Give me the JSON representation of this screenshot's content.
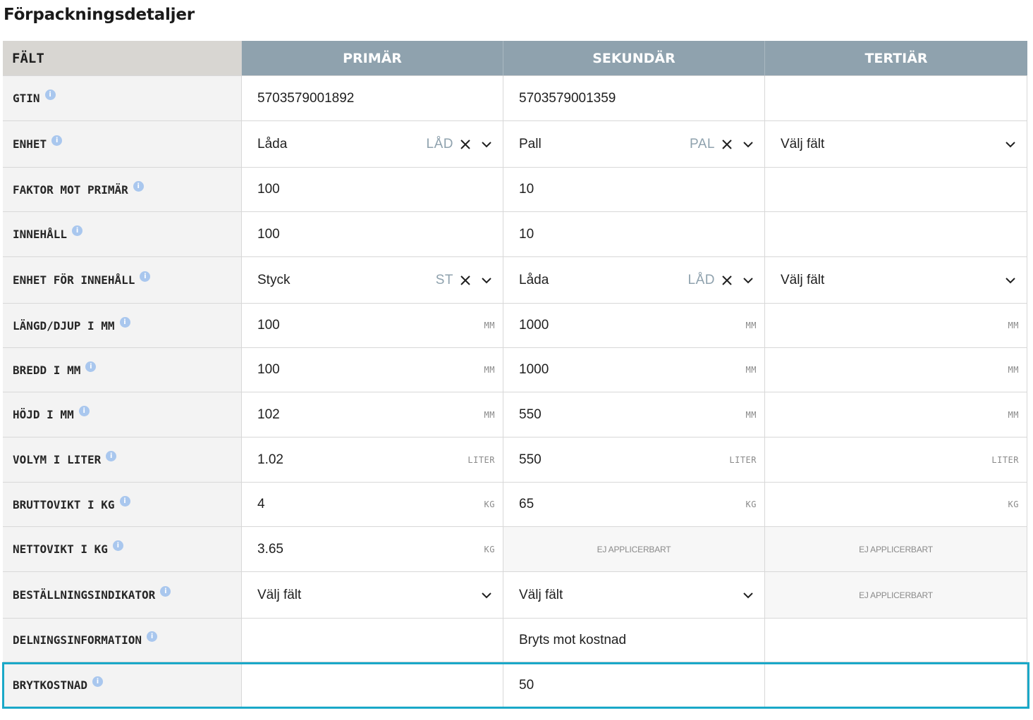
{
  "title": "Förpackningsdetaljer",
  "headers": {
    "field": "FÄLT",
    "primary": "PRIMÄR",
    "secondary": "SEKUNDÄR",
    "tertiary": "TERTIÄR"
  },
  "info_glyph": "i",
  "icons": {
    "clear": "close-icon",
    "dropdown": "chevron-down-icon",
    "info": "info-icon"
  },
  "colors": {
    "header_bg": "#8fa2ae",
    "field_header_bg": "#d8d6d2",
    "label_bg": "#f3f3f3",
    "highlight": "#1aa8c8",
    "info": "#a9c7ee"
  },
  "rows": [
    {
      "label": "GTIN",
      "primary": {
        "value": "5703579001892"
      },
      "secondary": {
        "value": "5703579001359"
      },
      "tertiary": {
        "value": ""
      }
    },
    {
      "label": "ENHET",
      "primary": {
        "value": "Låda",
        "abbr": "LÅD"
      },
      "secondary": {
        "value": "Pall",
        "abbr": "PAL"
      },
      "tertiary": {
        "value": "Välj fält"
      }
    },
    {
      "label": "FAKTOR MOT PRIMÄR",
      "primary": {
        "value": "100"
      },
      "secondary": {
        "value": "10"
      },
      "tertiary": {
        "value": ""
      }
    },
    {
      "label": "INNEHÅLL",
      "primary": {
        "value": "100"
      },
      "secondary": {
        "value": "10"
      },
      "tertiary": {
        "value": ""
      }
    },
    {
      "label": "ENHET FÖR INNEHÅLL",
      "primary": {
        "value": "Styck",
        "abbr": "ST"
      },
      "secondary": {
        "value": "Låda",
        "abbr": "LÅD"
      },
      "tertiary": {
        "value": "Välj fält"
      }
    },
    {
      "label": "LÄNGD/DJUP I MM",
      "primary": {
        "value": "100",
        "unit": "MM"
      },
      "secondary": {
        "value": "1000",
        "unit": "MM"
      },
      "tertiary": {
        "value": "",
        "unit": "MM"
      }
    },
    {
      "label": "BREDD I MM",
      "primary": {
        "value": "100",
        "unit": "MM"
      },
      "secondary": {
        "value": "1000",
        "unit": "MM"
      },
      "tertiary": {
        "value": "",
        "unit": "MM"
      }
    },
    {
      "label": "HÖJD I MM",
      "primary": {
        "value": "102",
        "unit": "MM"
      },
      "secondary": {
        "value": "550",
        "unit": "MM"
      },
      "tertiary": {
        "value": "",
        "unit": "MM"
      }
    },
    {
      "label": "VOLYM I LITER",
      "primary": {
        "value": "1.02",
        "unit": "LITER"
      },
      "secondary": {
        "value": "550",
        "unit": "LITER"
      },
      "tertiary": {
        "value": "",
        "unit": "LITER"
      }
    },
    {
      "label": "BRUTTOVIKT I KG",
      "primary": {
        "value": "4",
        "unit": "KG"
      },
      "secondary": {
        "value": "65",
        "unit": "KG"
      },
      "tertiary": {
        "value": "",
        "unit": "KG"
      }
    },
    {
      "label": "NETTOVIKT I KG",
      "primary": {
        "value": "3.65",
        "unit": "KG"
      },
      "secondary": {
        "value": "EJ APPLICERBART"
      },
      "tertiary": {
        "value": "EJ APPLICERBART"
      }
    },
    {
      "label": "BESTÄLLNINGSINDIKATOR",
      "primary": {
        "value": "Välj fält"
      },
      "secondary": {
        "value": "Välj fält"
      },
      "tertiary": {
        "value": "EJ APPLICERBART"
      }
    },
    {
      "label": "DELNINGSINFORMATION",
      "primary": {
        "value": ""
      },
      "secondary": {
        "value": "Bryts mot kostnad"
      },
      "tertiary": {
        "value": ""
      }
    },
    {
      "label": "BRYTKOSTNAD",
      "primary": {
        "value": ""
      },
      "secondary": {
        "value": "50"
      },
      "tertiary": {
        "value": ""
      }
    }
  ]
}
